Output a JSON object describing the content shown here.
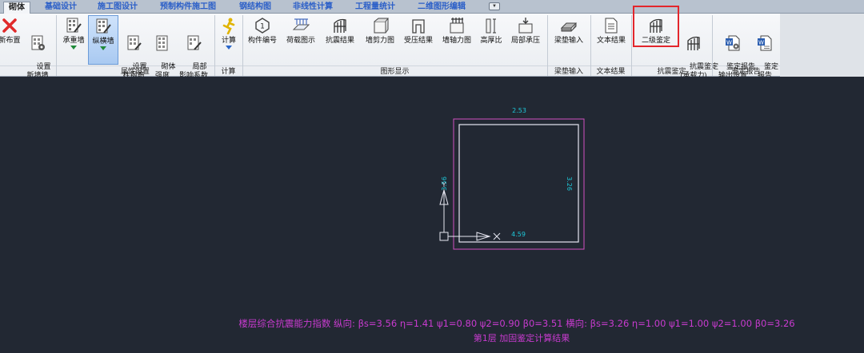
{
  "tabs": [
    {
      "label": "砌体",
      "active": true
    },
    {
      "label": "基础设计"
    },
    {
      "label": "施工图设计"
    },
    {
      "label": "预制构件施工图"
    },
    {
      "label": "钢结构图"
    },
    {
      "label": "非线性计算"
    },
    {
      "label": "工程量统计"
    },
    {
      "label": "二维图形编辑"
    }
  ],
  "ribbon": {
    "buttons": [
      {
        "label": "新布置",
        "icon": "red-x-icon"
      },
      {
        "label": "设置\n新墙墙",
        "icon": "settings-grid-icon"
      },
      {
        "label": "承重墙",
        "icon": "wall-edit-icon"
      },
      {
        "label": "纵横墙",
        "icon": "wall-edit-icon",
        "selected": true
      },
      {
        "label": "设置\n柱钢筋",
        "icon": "column-rebar-icon"
      },
      {
        "label": "砌体\n强度",
        "icon": "masonry-strength-icon"
      },
      {
        "label": "局部\n影响系数",
        "icon": "local-factor-icon"
      },
      {
        "label": "计算",
        "icon": "running-man-icon"
      },
      {
        "label": "构件编号",
        "icon": "component-number-icon"
      },
      {
        "label": "荷载图示",
        "icon": "load-diagram-icon"
      },
      {
        "label": "抗震结果",
        "icon": "seismic-result-icon"
      },
      {
        "label": "墙剪力图",
        "icon": "wall-shear-icon"
      },
      {
        "label": "受压结果",
        "icon": "compression-result-icon"
      },
      {
        "label": "墙轴力图",
        "icon": "wall-axial-icon"
      },
      {
        "label": "高厚比",
        "icon": "height-thickness-icon"
      },
      {
        "label": "局部承压",
        "icon": "local-bearing-icon"
      },
      {
        "label": "梁垫输入",
        "icon": "beam-pad-icon"
      },
      {
        "label": "文本结果",
        "icon": "text-result-icon"
      },
      {
        "label": "二级鉴定",
        "icon": "level2-appraisal-icon"
      },
      {
        "label": "抗震鉴定\n(承载力)",
        "icon": "seismic-appraisal-icon"
      },
      {
        "label": "鉴定报告\n输出设置",
        "icon": "report-settings-icon"
      },
      {
        "label": "鉴定\n报告",
        "icon": "report-word-icon"
      }
    ],
    "groups": [
      {
        "label": "属性设置"
      },
      {
        "label": "计算"
      },
      {
        "label": "图形显示"
      },
      {
        "label": "梁垫输入"
      },
      {
        "label": "文本结果"
      },
      {
        "label": "抗震鉴定"
      },
      {
        "label": "鉴定报告"
      }
    ]
  },
  "drawing": {
    "top_dim": "2.53",
    "right_dim": "3.26",
    "bottom_dim": "4.59",
    "left_dim": "3.56",
    "axis_x": "X",
    "axis_y": "Y",
    "summary_line": "楼层综合抗震能力指数 纵向:  βs=3.56  η=1.41  ψ1=0.80  ψ2=0.90  β0=3.51  横向:  βs=3.26  η=1.00  ψ1=1.00  ψ2=1.00  β0=3.26",
    "caption": "第1层  加固鉴定计算结果"
  },
  "colors": {
    "canvas_bg": "#222833",
    "wall_line": "#d14fc0",
    "dimension_text": "#1ec7d8",
    "summary_text": "#c93bd0",
    "highlight_box": "#e3262c"
  }
}
